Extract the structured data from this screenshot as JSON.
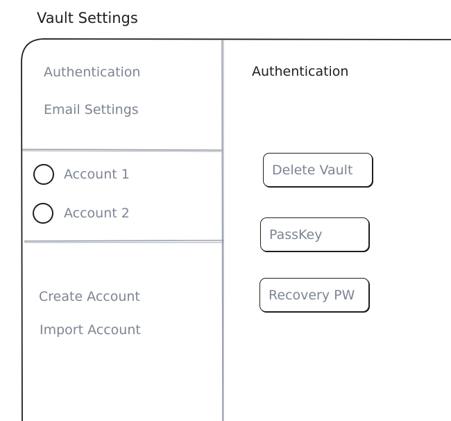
{
  "window": {
    "title": "Vault Settings"
  },
  "sidebar": {
    "top_items": [
      {
        "label": "Authentication"
      },
      {
        "label": "Email Settings"
      }
    ],
    "accounts": [
      {
        "label": "Account 1"
      },
      {
        "label": "Account 2"
      }
    ],
    "bottom_items": [
      {
        "label": "Create Account"
      },
      {
        "label": "Import Account"
      }
    ]
  },
  "main": {
    "heading": "Authentication",
    "buttons": {
      "delete_vault": "Delete Vault",
      "passkey": "PassKey",
      "recovery_pw": "Recovery PW"
    }
  },
  "colors": {
    "ink": "#1e1e1e",
    "muted_text": "#7d8593",
    "divider": "#9aa1ad"
  }
}
